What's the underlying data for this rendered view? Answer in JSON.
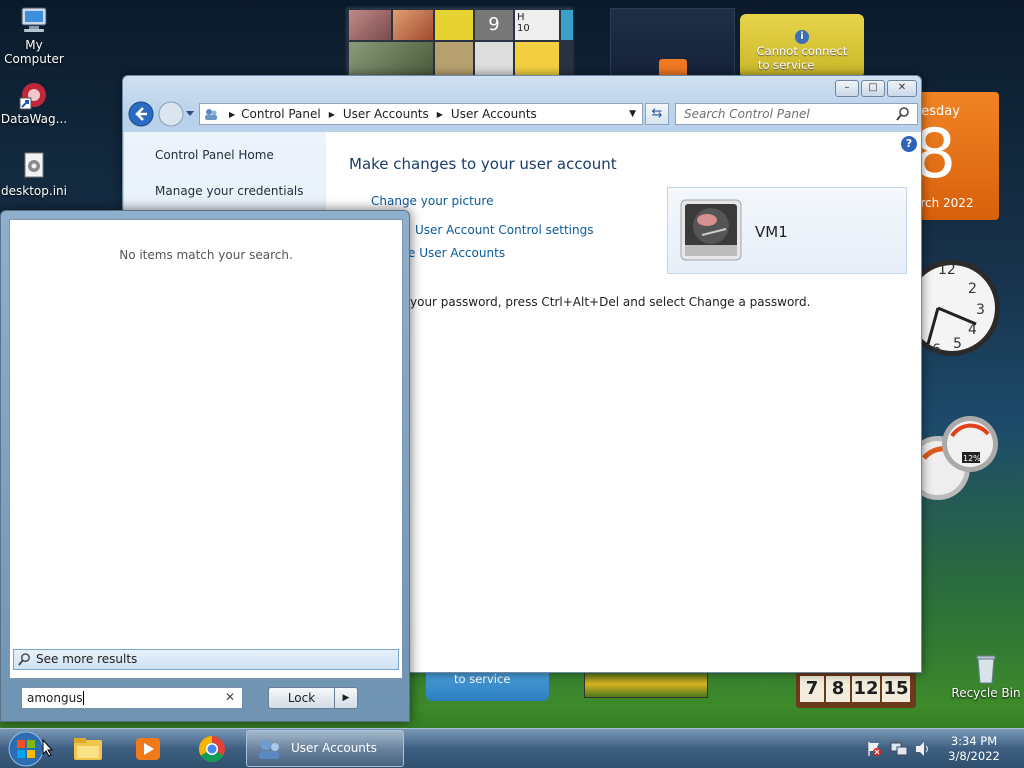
{
  "desktop": {
    "icons": [
      {
        "label": "My\nComputer",
        "icon": "computer-icon"
      },
      {
        "label": "DataWag...",
        "icon": "shortcut-icon"
      },
      {
        "label": "desktop.ini",
        "icon": "settings-file-icon"
      }
    ],
    "recycle_bin": "Recycle Bin"
  },
  "gadgets": {
    "weather_msg": "Cannot connect to service",
    "weather_msg_line1": "Cannot connect",
    "weather_msg_line2": "to service",
    "lower_connect_msg": "to service",
    "calendar_day": "uesday",
    "calendar_date": "8",
    "calendar_month": "arch 2022",
    "clock_numbers": [
      "12",
      "2",
      "3",
      "4",
      "5",
      "6"
    ],
    "cpu_percent": "12%",
    "puzzle_numbers": [
      "7",
      "8",
      "12",
      "15"
    ],
    "slideshow_numbers": [
      "9",
      "H",
      "10"
    ]
  },
  "window": {
    "title": "User Accounts",
    "breadcrumb": [
      "Control Panel",
      "User Accounts",
      "User Accounts"
    ],
    "search_placeholder": "Search Control Panel",
    "help": "?",
    "left_nav": [
      "Control Panel Home",
      "Manage your credentials"
    ],
    "heading": "Make changes to your user account",
    "tasks": [
      "Change your picture",
      "User Account Control settings",
      "e User Accounts"
    ],
    "task_prefix": "t",
    "password_note": "your password, press Ctrl+Alt+Del and select Change a password.",
    "user_name": "VM1"
  },
  "start_menu": {
    "no_items": "No items match your search.",
    "see_more": "See more results",
    "search_value": "amongus",
    "lock_label": "Lock"
  },
  "taskbar": {
    "active_window": "User Accounts",
    "time": "3:34 PM",
    "date": "3/8/2022"
  }
}
